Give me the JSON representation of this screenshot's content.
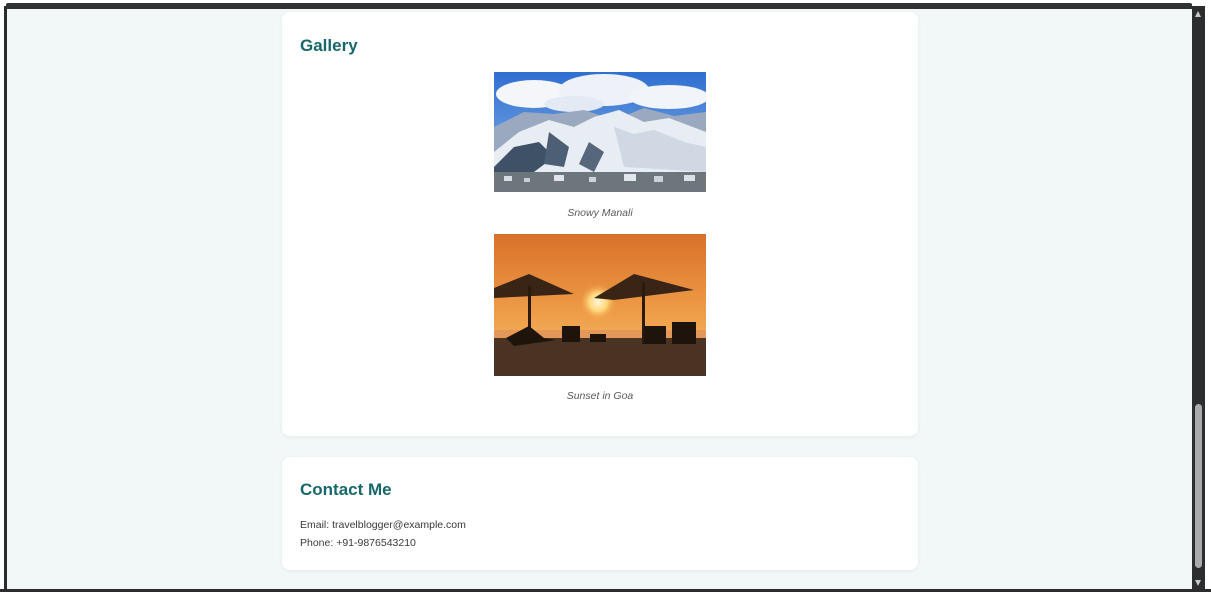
{
  "gallery": {
    "title": "Gallery",
    "images": [
      {
        "caption": "Snowy Manali",
        "alt": "Snowy Manali"
      },
      {
        "caption": "Sunset in Goa",
        "alt": "Sunset in Goa"
      }
    ]
  },
  "contact": {
    "title": "Contact Me",
    "email_line": "Email: travelblogger@example.com",
    "phone_line": "Phone: +91-9876543210"
  },
  "colors": {
    "page_background": "#f2f8f8",
    "heading": "#17686a",
    "card": "#ffffff"
  }
}
